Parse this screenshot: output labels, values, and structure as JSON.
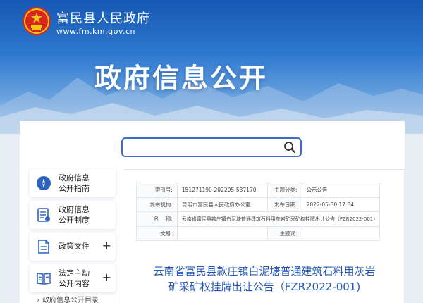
{
  "site": {
    "name": "富民县人民政府",
    "url": "www.fm.km.gov.cn",
    "section_title": "政府信息公开"
  },
  "search": {
    "value": "",
    "icon": "search-icon"
  },
  "sidebar": {
    "items": [
      {
        "label": "政府信息\n公开指南",
        "icon": "compass-icon",
        "expandable": false
      },
      {
        "label": "政府信息\n公开制度",
        "icon": "document-icon",
        "expandable": false
      },
      {
        "label": "政策文件",
        "icon": "file-icon",
        "expandable": true,
        "plus": "+"
      },
      {
        "label": "法定主动\n公开内容",
        "icon": "book-icon",
        "expandable": true,
        "plus": "+"
      }
    ],
    "sub_item": "政府信息公开目录"
  },
  "meta": {
    "index_no_label": "索引号:",
    "index_no": "151271190-202205-537170",
    "category_label": "主题分类:",
    "category": "公示公告",
    "publisher_label": "发布机构:",
    "publisher": "昆明市富民县人民政府办公室",
    "date_label": "发布日期:",
    "date": "2022-05-30 17:34",
    "name_label": "名    称:",
    "name": "云南省富民县款庄镇白泥塘普通建筑石料用灰岩矿采矿权挂牌出让公告（FZR2022-001)",
    "doc_no_label": "文号:",
    "doc_no": "",
    "keywords_label": "主题词:",
    "keywords": ""
  },
  "document": {
    "title_line1": "云南省富民县款庄镇白泥塘普通建筑石料用灰岩",
    "title_line2": "矿采矿权挂牌出让公告（FZR2022-001)"
  },
  "colors": {
    "banner_top": "#1658b5",
    "accent_blue": "#2459b7",
    "search_border": "#3a6fc5",
    "icon_blue": "#2f64be"
  }
}
